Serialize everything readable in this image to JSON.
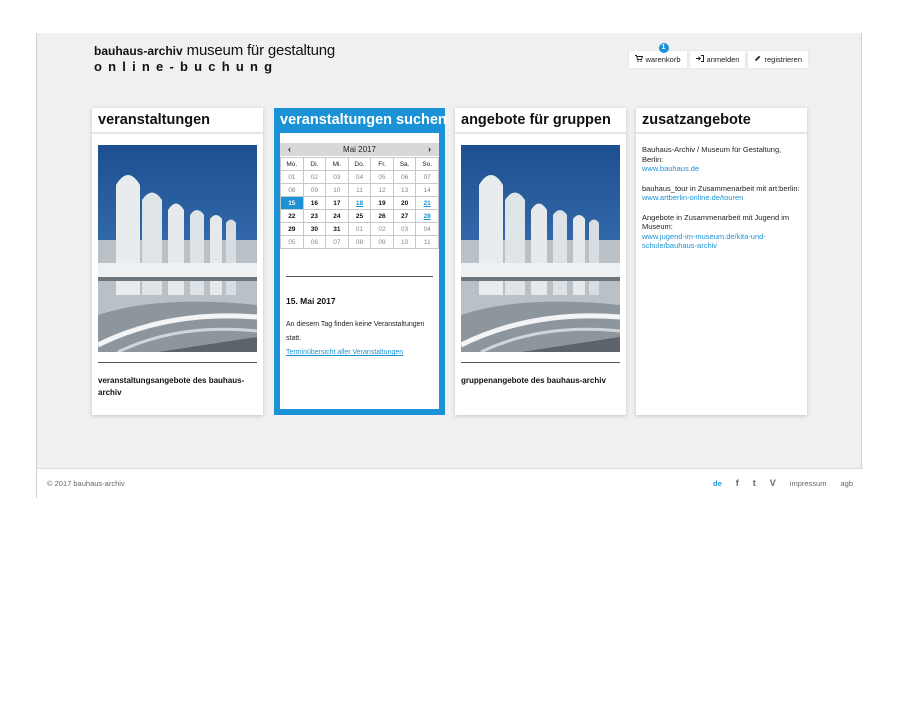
{
  "header": {
    "logo_brand": "bauhaus-archiv",
    "logo_rest": " museum für gestaltung",
    "logo_sub": "online-buchung"
  },
  "nav": {
    "cart_count": "1",
    "cart_label": "warenkorb",
    "login_label": "anmelden",
    "register_label": "registrieren"
  },
  "cards": {
    "events": {
      "title": "veranstaltungen",
      "caption": "veranstaltungsangebote des bauhaus-archiv"
    },
    "search": {
      "title": "veranstaltungen suchen"
    },
    "groups": {
      "title": "angebote für gruppen",
      "caption": "gruppenangebote des bauhaus-archiv"
    },
    "extras": {
      "title": "zusatzangebote",
      "items": [
        {
          "text": "Bauhaus-Archiv / Museum für Gestaltung, Berlin:",
          "link": "www.bauhaus.de"
        },
        {
          "text": "bauhaus_tour in Zusammenarbeit mit art:berlin:",
          "link": "www.artberlin-online.de/touren"
        },
        {
          "text": "Angebote in Zusammenarbeit mit Jugend im Museum:",
          "link": "www.jugend-im-museum.de/kita-und-schule/bauhaus-archiv"
        }
      ]
    }
  },
  "calendar": {
    "month": "Mai 2017",
    "prev_icon": "chevron-left-icon",
    "next_icon": "chevron-right-icon",
    "weekdays": [
      "Mo.",
      "Di.",
      "Mi.",
      "Do.",
      "Fr.",
      "Sa.",
      "So."
    ],
    "weeks": [
      [
        "01",
        "02",
        "03",
        "04",
        "05",
        "06",
        "07"
      ],
      [
        "08",
        "09",
        "10",
        "11",
        "12",
        "13",
        "14"
      ],
      [
        "15",
        "16",
        "17",
        "18",
        "19",
        "20",
        "21"
      ],
      [
        "22",
        "23",
        "24",
        "25",
        "26",
        "27",
        "28"
      ],
      [
        "29",
        "30",
        "31",
        "01",
        "02",
        "03",
        "04"
      ],
      [
        "05",
        "06",
        "07",
        "08",
        "09",
        "10",
        "11"
      ]
    ],
    "selected_day": "15. Mai 2017",
    "day_text": "An diesem Tag finden keine Veranstaltungen statt.",
    "day_link": "Terminübersicht aller Veranstaltungen"
  },
  "footer": {
    "copyright": "© 2017 bauhaus-archiv",
    "lang": "de",
    "facebook": "f",
    "twitter": "t",
    "vimeo": "V",
    "impressum": "impressum",
    "agb": "agb"
  },
  "colors": {
    "accent": "#1b92d6",
    "background": "#f0f0f0"
  }
}
